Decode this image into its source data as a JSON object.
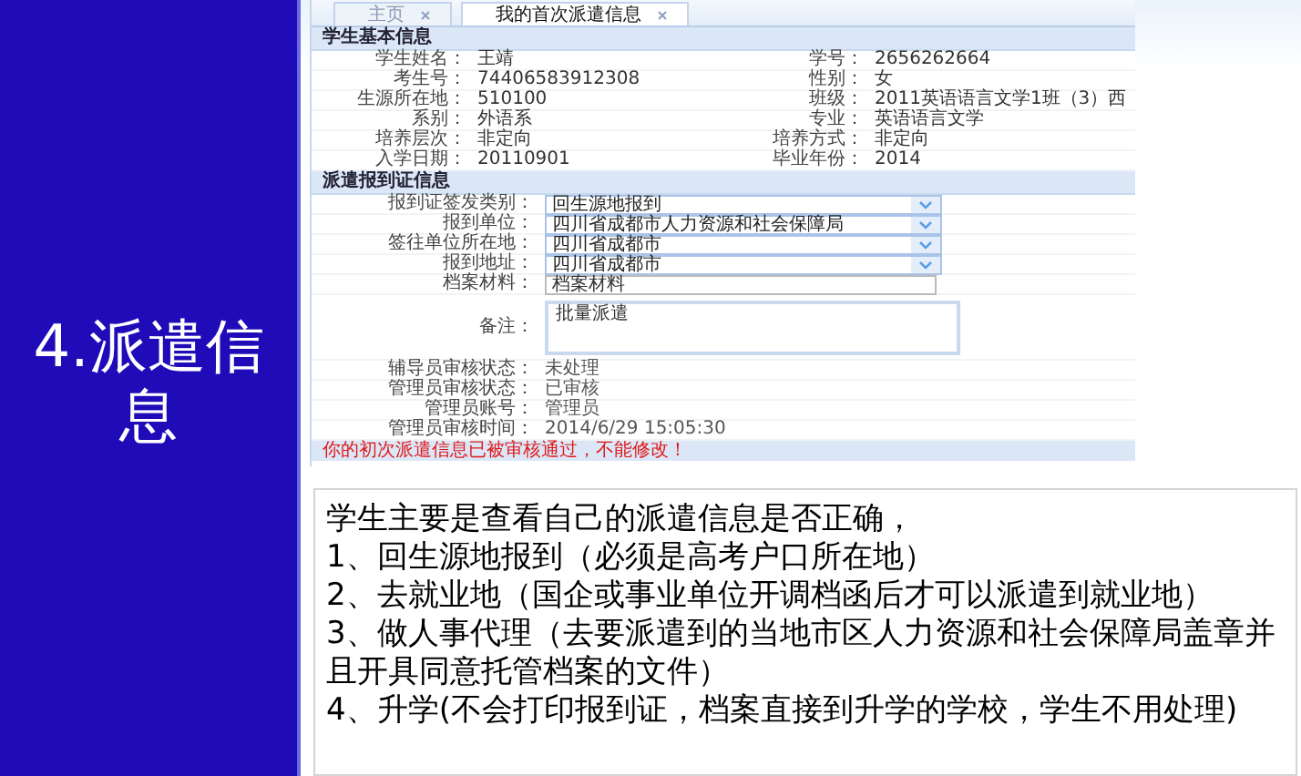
{
  "slide_title": "4.派遣信息",
  "tabs": [
    {
      "label": "主页",
      "selected": false
    },
    {
      "label": "我的首次派遣信息",
      "selected": true
    }
  ],
  "basic_info": {
    "title": "学生基本信息",
    "fields": [
      {
        "label": "学生姓名：",
        "value": "王靖"
      },
      {
        "label": "学号：",
        "value": "2656262664"
      },
      {
        "label": "考生号：",
        "value": "74406583912308"
      },
      {
        "label": "性别：",
        "value": "女"
      },
      {
        "label": "生源所在地：",
        "value": "510100"
      },
      {
        "label": "班级：",
        "value": "2011英语语言文学1班（3）西"
      },
      {
        "label": "系别：",
        "value": "外语系"
      },
      {
        "label": "专业：",
        "value": "英语语言文学"
      },
      {
        "label": "培养层次：",
        "value": "非定向"
      },
      {
        "label": "培养方式：",
        "value": "非定向"
      },
      {
        "label": "入学日期：",
        "value": "20110901"
      },
      {
        "label": "毕业年份：",
        "value": "2014"
      }
    ]
  },
  "dispatch_info": {
    "title": "派遣报到证信息",
    "fields": [
      {
        "kind": "select",
        "label": "报到证签发类别：",
        "value": "回生源地报到"
      },
      {
        "kind": "select",
        "label": "报到单位：",
        "value": "四川省成都市人力资源和社会保障局"
      },
      {
        "kind": "select",
        "label": "签往单位所在地：",
        "value": "四川省成都市"
      },
      {
        "kind": "select",
        "label": "报到地址：",
        "value": "四川省成都市"
      },
      {
        "kind": "input",
        "label": "档案材料：",
        "value": "档案材料"
      },
      {
        "kind": "textarea",
        "label": "备注：",
        "value": "批量派遣"
      },
      {
        "kind": "text",
        "label": "辅导员审核状态：",
        "value": "未处理"
      },
      {
        "kind": "text",
        "label": "管理员审核状态：",
        "value": "已审核"
      },
      {
        "kind": "text",
        "label": "管理员账号：",
        "value": "管理员"
      },
      {
        "kind": "text",
        "label": "管理员审核时间：",
        "value": "2014/6/29 15:05:30"
      }
    ],
    "notice": "你的初次派遣信息已被审核通过，不能修改！"
  },
  "description": {
    "paragraphs": [
      "学生主要是查看自己的派遣信息是否正确，",
      "1、回生源地报到（必须是高考户口所在地）",
      "2、去就业地（国企或事业单位开调档函后才可以派遣到就业地）",
      "3、做人事代理（去要派遣到的当地市区人力资源和社会保障局盖章并且开具同意托管档案的文件）",
      "4、升学(不会打印报到证，档案直接到升学的学校，学生不用处理)"
    ]
  }
}
